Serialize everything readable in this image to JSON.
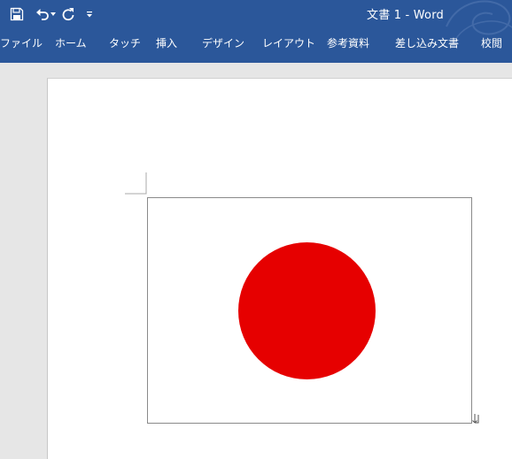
{
  "window": {
    "title": "文書 1 - Word"
  },
  "quick_access": {
    "save_icon": "save-icon",
    "undo_icon": "undo-icon",
    "redo_icon": "redo-icon",
    "customize_icon": "customize-qat-icon"
  },
  "ribbon": {
    "tabs": [
      {
        "label": "ファイル"
      },
      {
        "label": "ホーム"
      },
      {
        "label": "タッチ"
      },
      {
        "label": "挿入"
      },
      {
        "label": "デザイン"
      },
      {
        "label": "レイアウト"
      },
      {
        "label": "参考資料"
      },
      {
        "label": "差し込み文書"
      },
      {
        "label": "校閲"
      }
    ]
  },
  "document": {
    "flag_image": {
      "icon": "japan-flag-image",
      "disc_color": "#e60000",
      "field_color": "#ffffff"
    }
  },
  "colors": {
    "title_bar": "#2b579a",
    "workspace": "#e6e6e6"
  }
}
